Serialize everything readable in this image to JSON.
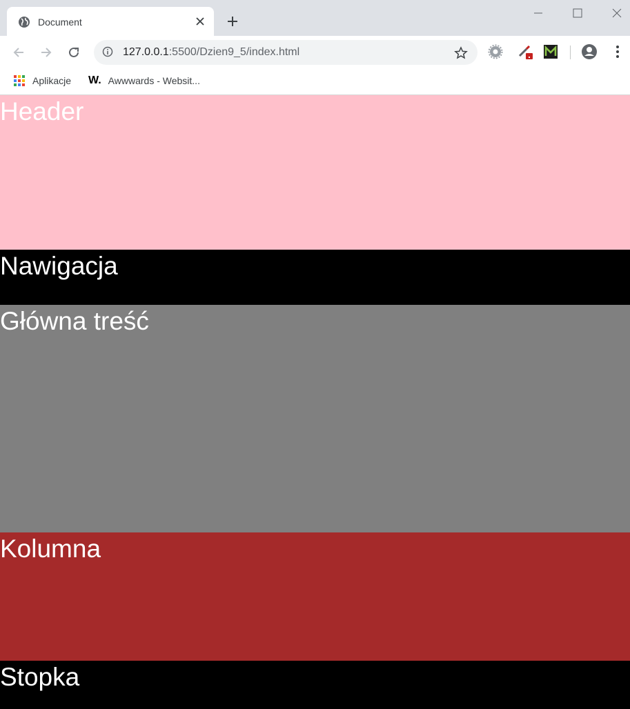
{
  "browser": {
    "tab": {
      "title": "Document"
    },
    "address_bar": {
      "url_host": "127.0.0.1",
      "url_path": ":5500/Dzien9_5/index.html"
    },
    "bookmarks": [
      {
        "label": "Aplikacje",
        "icon": "apps-grid-icon"
      },
      {
        "label": "Awwwards - Websit...",
        "icon": "awwwards-logo-icon"
      }
    ],
    "extensions": [
      "settings-gear-icon",
      "color-picker-icon",
      "m-extension-icon"
    ],
    "colors": {
      "tabstrip": "#dee1e6",
      "omnibox": "#f1f3f4"
    }
  },
  "page": {
    "sections": [
      {
        "label": "Header",
        "color": "#ffc0cb"
      },
      {
        "label": "Nawigacja",
        "color": "#000000"
      },
      {
        "label": "Główna treść",
        "color": "#808080"
      },
      {
        "label": "Kolumna",
        "color": "#a52a2a"
      },
      {
        "label": "Stopka",
        "color": "#000000"
      }
    ]
  }
}
